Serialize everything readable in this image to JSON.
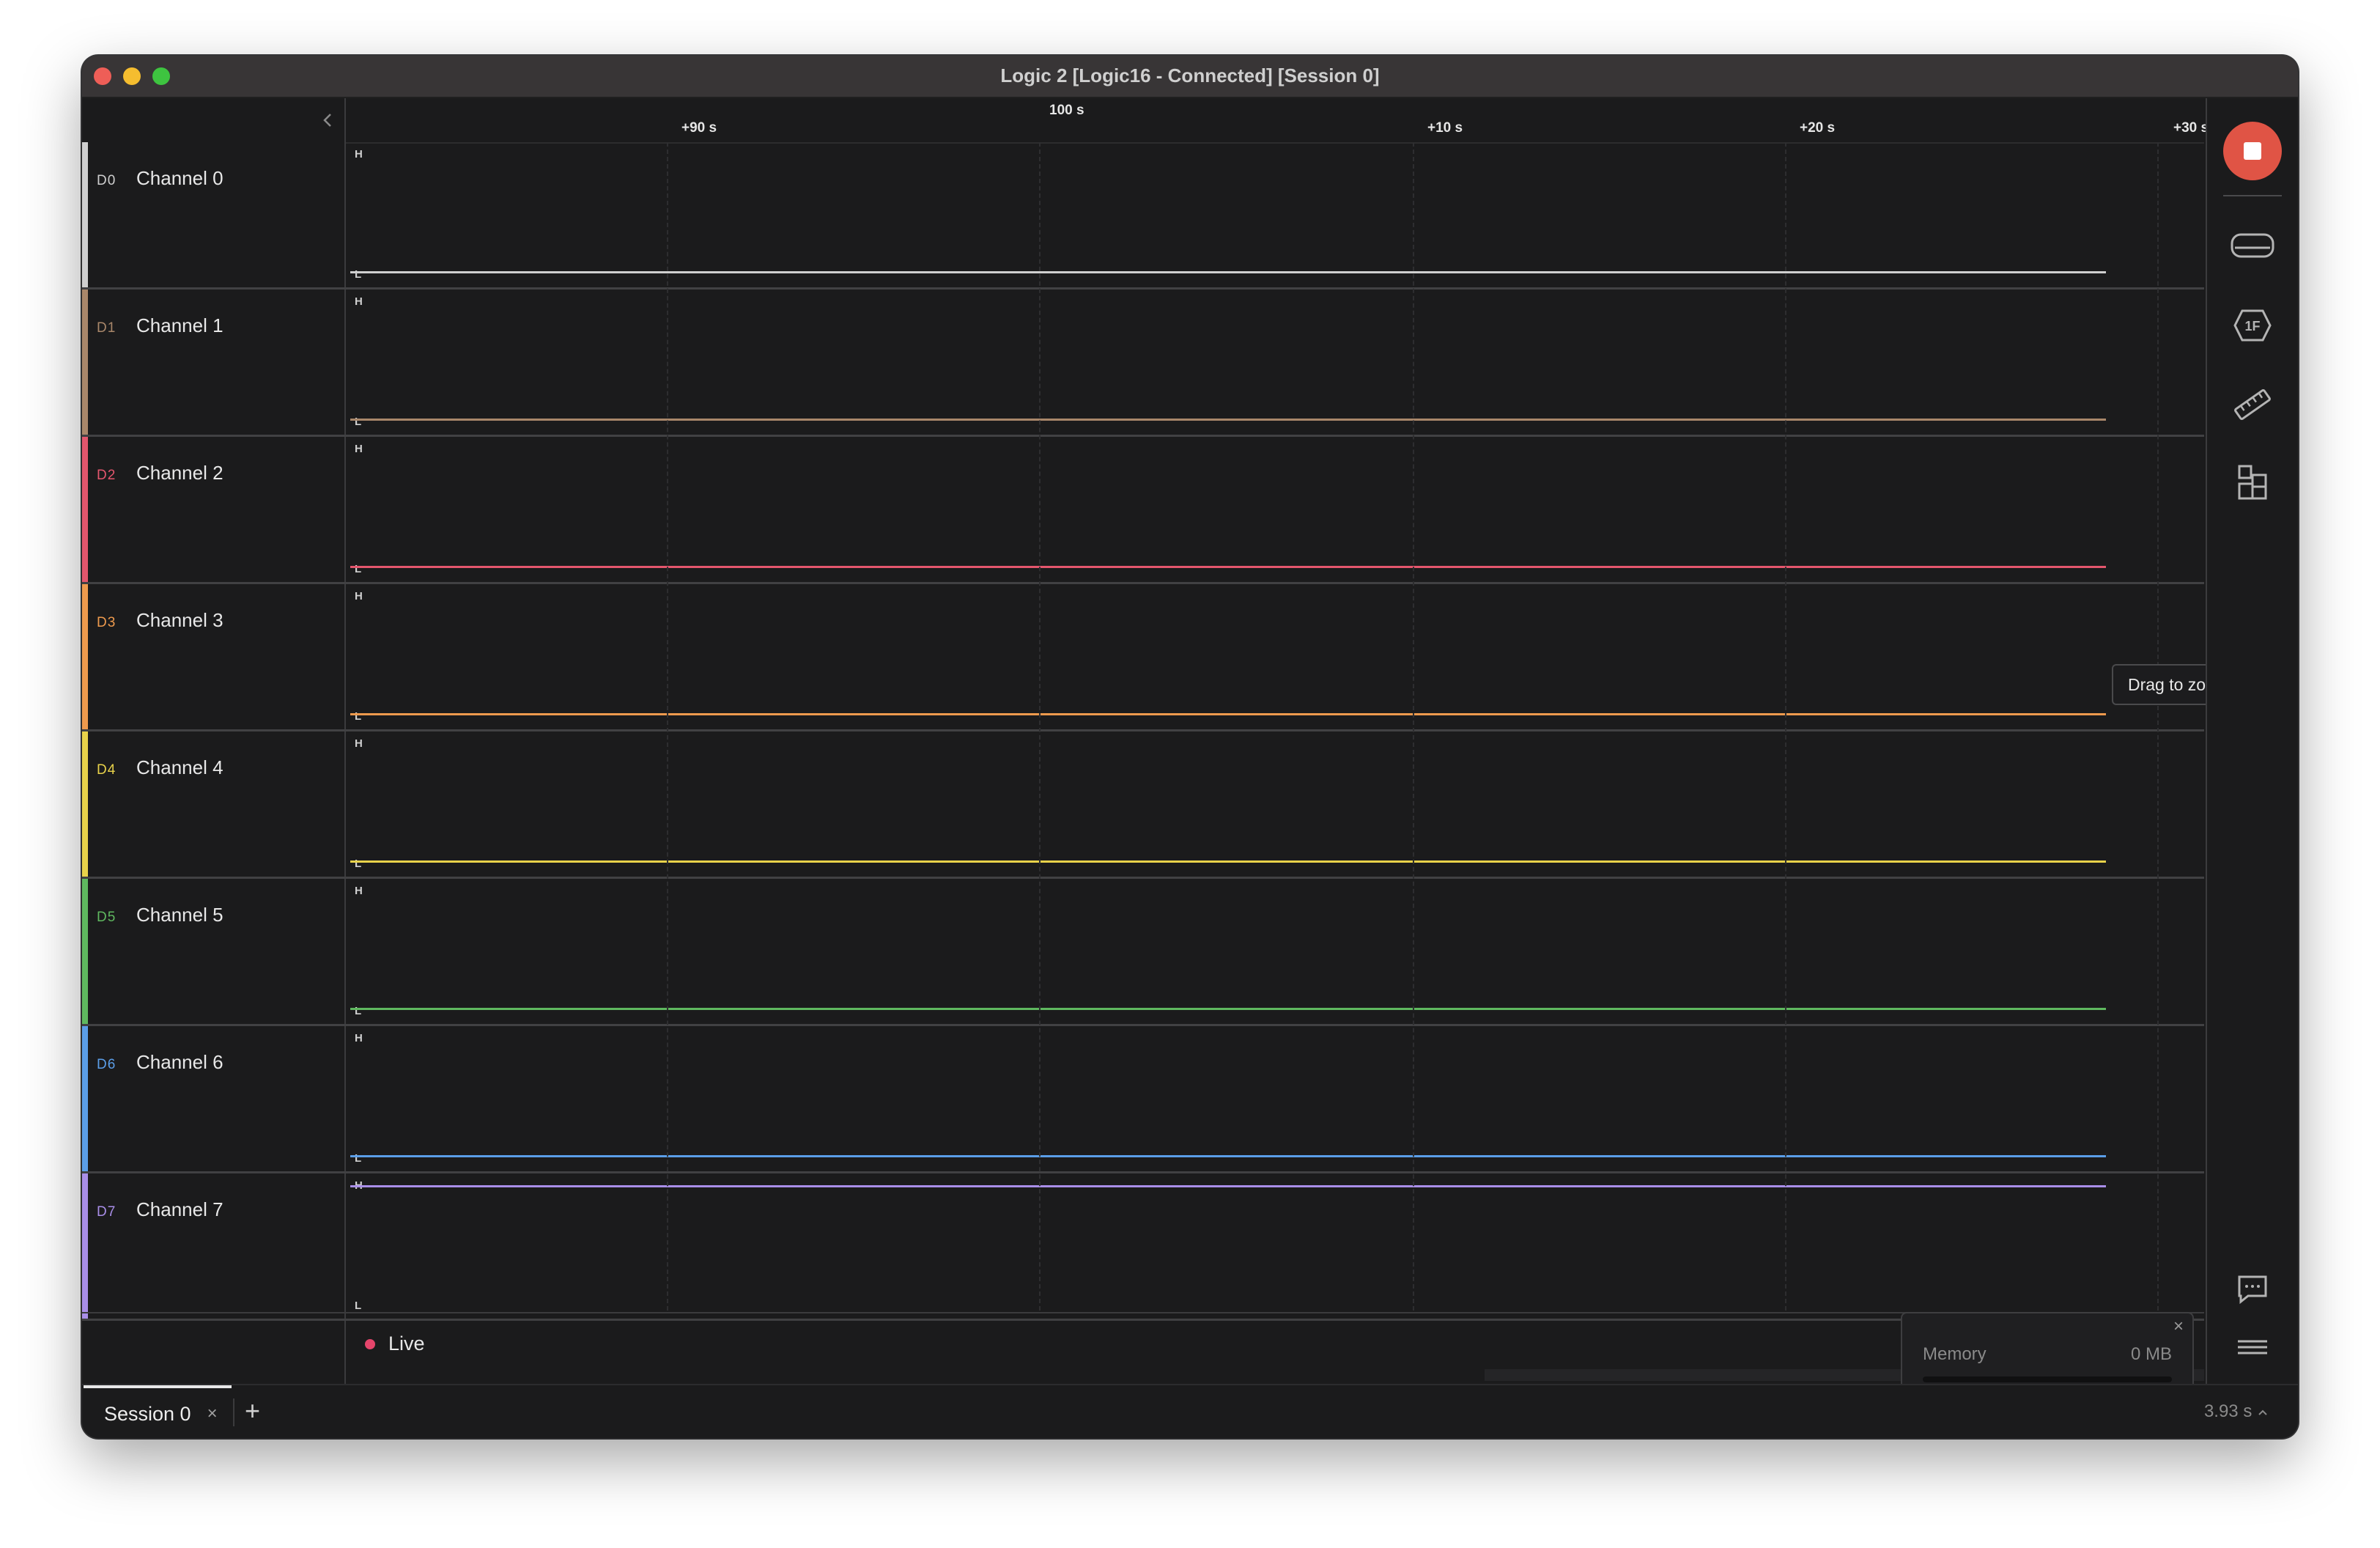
{
  "window": {
    "title": "Logic 2 [Logic16 - Connected] [Session 0]"
  },
  "ruler": {
    "ticks": [
      "+90 s",
      "100 s",
      "+10 s",
      "+20 s",
      "+30 s"
    ]
  },
  "channels": [
    {
      "id": "D0",
      "name": "Channel 0",
      "color": "#cfcfcf",
      "state": "L"
    },
    {
      "id": "D1",
      "name": "Channel 1",
      "color": "#a9876a",
      "state": "L"
    },
    {
      "id": "D2",
      "name": "Channel 2",
      "color": "#e4566d",
      "state": "L"
    },
    {
      "id": "D3",
      "name": "Channel 3",
      "color": "#ee9a4d",
      "state": "L"
    },
    {
      "id": "D4",
      "name": "Channel 4",
      "color": "#e8d24a",
      "state": "L"
    },
    {
      "id": "D5",
      "name": "Channel 5",
      "color": "#5fb85f",
      "state": "L"
    },
    {
      "id": "D6",
      "name": "Channel 6",
      "color": "#5b9ee8",
      "state": "L"
    },
    {
      "id": "D7",
      "name": "Channel 7",
      "color": "#a98ee8",
      "state": "H"
    }
  ],
  "levels": {
    "high": "H",
    "low": "L"
  },
  "capture": {
    "live_label": "Live"
  },
  "memory": {
    "label": "Memory",
    "value": "0 MB",
    "close": "×",
    "fill_fraction": 0
  },
  "tooltip": "Drag to zoom",
  "tabs": [
    {
      "label": "Session 0",
      "close": "×"
    }
  ],
  "add_tab": "+",
  "status": {
    "timer": "3.93 s"
  },
  "icons": {
    "record": "stop-record-icon",
    "sidebar": [
      "device-icon",
      "analyzers-icon",
      "measure-ruler-icon",
      "extensions-icon",
      "feedback-icon",
      "menu-icon"
    ]
  }
}
